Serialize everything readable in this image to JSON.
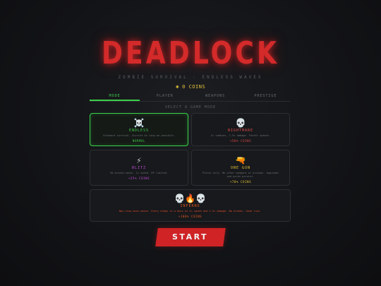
{
  "title": "DEADLOCK",
  "subtitle": "ZOMBIE SURVIVAL · ENDLESS WAVES",
  "coins": {
    "icon": "coin-icon",
    "label": "0 COINS"
  },
  "tabs": [
    "MODE",
    "PLAYER",
    "WEAPONS",
    "PRESTIGE"
  ],
  "active_tab": "MODE",
  "section_label": "SELECT A GAME MODE",
  "modes": {
    "endless": {
      "icon": "☠️",
      "name": "ENDLESS",
      "desc": "Standard survival. Survive as long as possible.",
      "reward": "NORMAL",
      "name_color": "#3ecf4a",
      "reward_color": "#3ecf4a",
      "selected": true
    },
    "nightmare": {
      "icon": "💀",
      "name": "NIGHTMARE",
      "desc": "2× zombies, 1.5× damage. Faster spawns.",
      "reward": "+50% COINS",
      "name_color": "#e04a4a",
      "reward_color": "#e04a4a",
      "selected": false
    },
    "blitz": {
      "icon": "⚡",
      "name": "BLITZ",
      "desc": "30-second waves. 2× speed. HP limited.",
      "reward": "+25% COINS",
      "name_color": "#c04ad8",
      "reward_color": "#c04ad8",
      "selected": false
    },
    "onegun": {
      "icon": "🔫",
      "name": "ONE GUN",
      "desc": "Pistol only. No other weapons or pickups. Upgrades and perks persist.",
      "reward": "+70% COINS",
      "name_color": "#e6c33a",
      "reward_color": "#e6c33a",
      "selected": false
    },
    "inferno": {
      "icon": "💀🔥💀",
      "name": "INFERNO",
      "desc": "Non-stop boss waves. Every enemy is a boss at 2× speed and 2.5× damage. No breaks. Good luck.",
      "reward": "+100% COINS",
      "name_color": "#e0581f",
      "reward_color": "#e0581f",
      "desc_color": "#d94a2a",
      "selected": false
    }
  },
  "start_label": "START",
  "colors": {
    "accent_green": "#3ecf4a",
    "title_red": "#d42a2a",
    "start_red": "#cf2326",
    "coin_gold": "#e6c33a"
  }
}
